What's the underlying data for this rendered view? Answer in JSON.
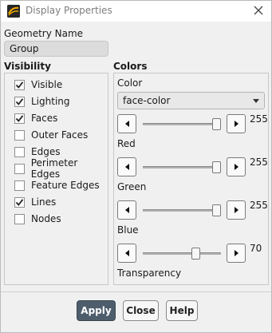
{
  "window": {
    "title": "Display Properties",
    "icon": "ansys-fluent-icon",
    "close_icon": "close-icon"
  },
  "geometry": {
    "label": "Geometry Name",
    "value": "Group"
  },
  "visibility": {
    "title": "Visibility",
    "items": [
      {
        "label": "Visible",
        "checked": true
      },
      {
        "label": "Lighting",
        "checked": true
      },
      {
        "label": "Faces",
        "checked": true
      },
      {
        "label": "Outer Faces",
        "checked": false
      },
      {
        "label": "Edges",
        "checked": false
      },
      {
        "label": "Perimeter Edges",
        "checked": false
      },
      {
        "label": "Feature Edges",
        "checked": false
      },
      {
        "label": "Lines",
        "checked": true
      },
      {
        "label": "Nodes",
        "checked": false
      }
    ]
  },
  "colors": {
    "title": "Colors",
    "color_label": "Color",
    "color_value": "face-color",
    "sliders": [
      {
        "label": "Red",
        "value": "255",
        "fraction": 1.0
      },
      {
        "label": "Green",
        "value": "255",
        "fraction": 1.0
      },
      {
        "label": "Blue",
        "value": "255",
        "fraction": 1.0
      },
      {
        "label": "Transparency",
        "value": "70",
        "fraction": 0.7
      }
    ]
  },
  "buttons": {
    "apply": "Apply",
    "close": "Close",
    "help": "Help"
  },
  "accent": "#4e5d6c"
}
